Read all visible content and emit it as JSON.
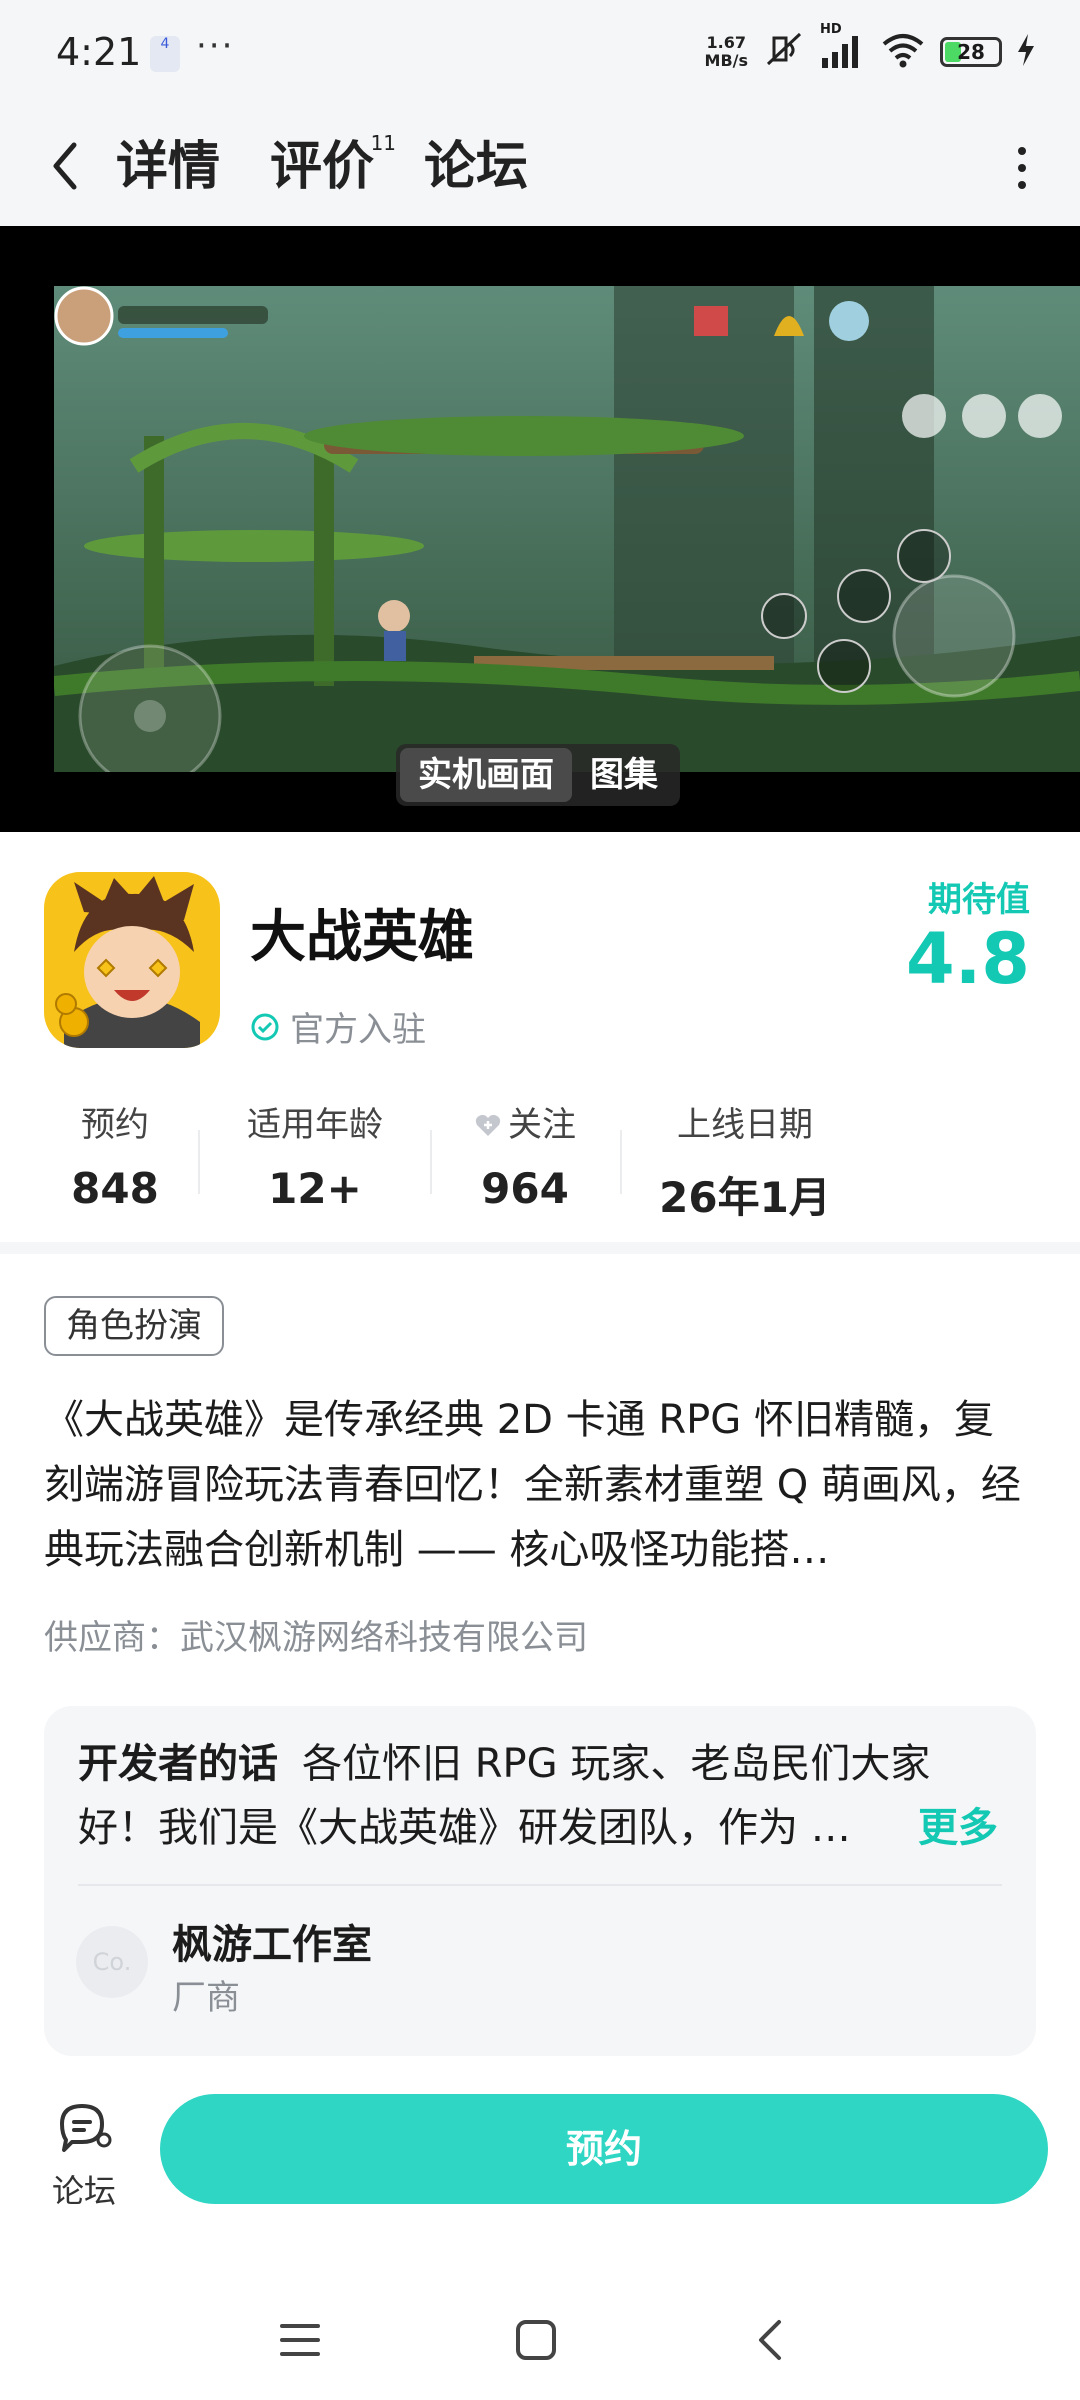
{
  "status_bar": {
    "time": "4:21",
    "notification_badge": "4",
    "more_dots": "···",
    "net_speed_value": "1.67",
    "net_speed_unit": "MB/s",
    "network_label": "HD",
    "battery": "28"
  },
  "header": {
    "tabs": [
      {
        "label": "详情",
        "active": true
      },
      {
        "label": "评价",
        "badge": "11"
      },
      {
        "label": "论坛"
      }
    ]
  },
  "media": {
    "mode_tabs": [
      "实机画面",
      "图集"
    ],
    "active_mode": "实机画面"
  },
  "app": {
    "name": "大战英雄",
    "official_label": "官方入驻",
    "score_label": "期待值",
    "score_value": "4.8",
    "stats": [
      {
        "label": "预约",
        "value": "848"
      },
      {
        "label": "适用年龄",
        "value": "12+"
      },
      {
        "label": "关注",
        "value": "964"
      },
      {
        "label": "上线日期",
        "value": "26年1月"
      }
    ]
  },
  "detail": {
    "tag": "角色扮演",
    "description": "《大战英雄》是传承经典 2D 卡通 RPG 怀旧精髓，复刻端游冒险玩法青春回忆！全新素材重塑 Q 萌画风，经典玩法融合创新机制 —— 核心吸怪功能搭…",
    "supplier": "供应商：武汉枫游网络科技有限公司"
  },
  "developer": {
    "title": "开发者的话",
    "text": "各位怀旧 RPG 玩家、老岛民们大家好！我们是《大战英雄》研发团队，作为 …",
    "more_label": "更多",
    "studio_avatar": "Co.",
    "studio_name": "枫游工作室",
    "studio_role": "厂商"
  },
  "bottom": {
    "forum_label": "论坛",
    "reserve_label": "预约"
  },
  "colors": {
    "accent": "#2fd6c3",
    "accent_text": "#14c9b4"
  }
}
